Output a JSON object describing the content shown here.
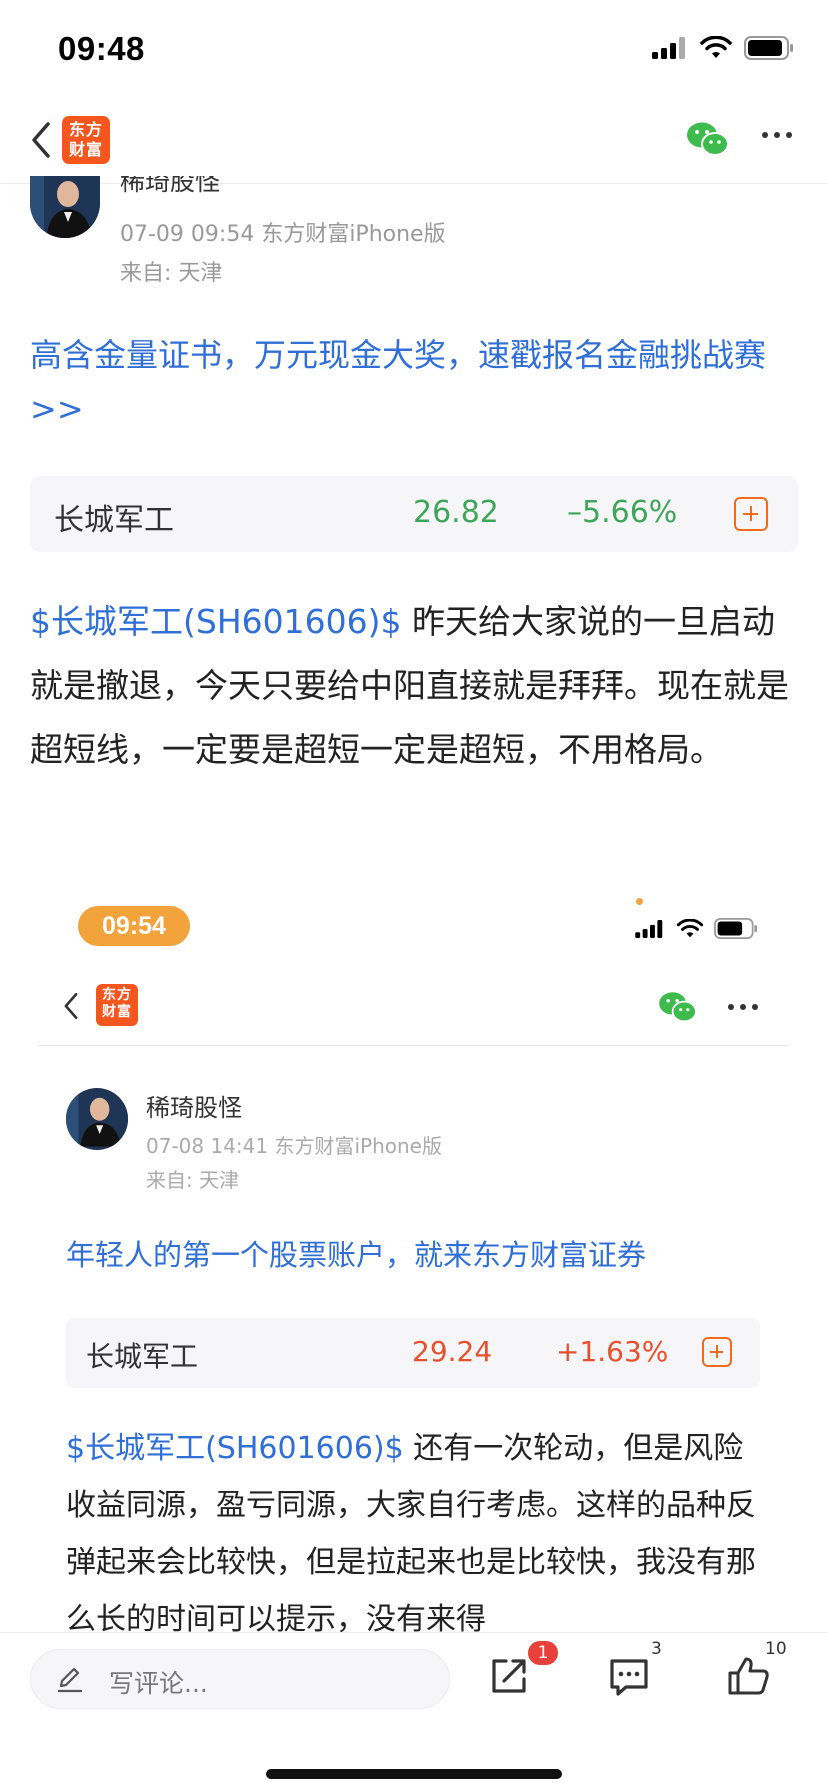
{
  "status_bar": {
    "time": "09:48"
  },
  "nav": {
    "logo_line1": "东方",
    "logo_line2": "财富"
  },
  "post": {
    "author": "稀琦股怪",
    "meta": "07-09 09:54 东方财富iPhone版",
    "from": "来自: 天津",
    "promo": "高含金量证书，万元现金大奖，速戳报名金融挑战赛>>",
    "stock": {
      "name": "长城军工",
      "price": "26.82",
      "change": "–5.66%"
    },
    "stock_tag": "$长城军工(SH601606)$",
    "body": " 昨天给大家说的一旦启动就是撤退，今天只要给中阳直接就是拜拜。现在就是超短线，一定要是超短一定是超短，不用格局。"
  },
  "embedded": {
    "time": "09:54",
    "author": "稀琦股怪",
    "meta": "07-08 14:41 东方财富iPhone版",
    "from": "来自: 天津",
    "promo": "年轻人的第一个股票账户，就来东方财富证券",
    "stock": {
      "name": "长城军工",
      "price": "29.24",
      "change": "+1.63%"
    },
    "stock_tag": "$长城军工(SH601606)$",
    "body": " 还有一次轮动，但是风险收益同源，盈亏同源，大家自行考虑。这样的品种反弹起来会比较快，但是拉起来也是比较快，我没有那么长的时间可以提示，没有来得"
  },
  "bottom": {
    "comment_placeholder": "写评论...",
    "share_badge": "1",
    "comment_count": "3",
    "like_count": "10"
  },
  "colors": {
    "accent_blue": "#2f6fd6",
    "up_red": "#e5502d",
    "down_green": "#3fa55a",
    "brand_orange": "#f5561d"
  }
}
